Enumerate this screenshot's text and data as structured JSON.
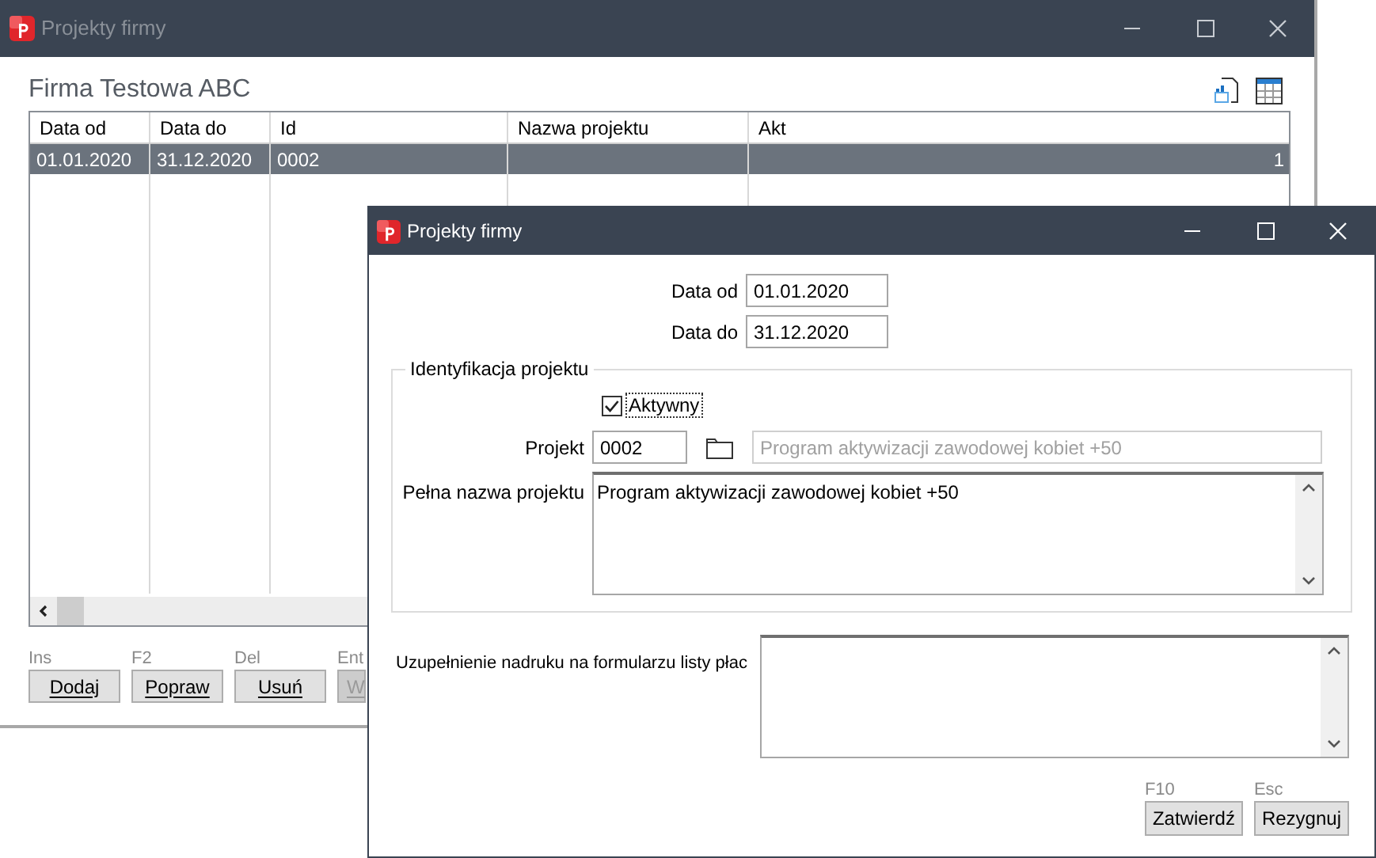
{
  "back_window": {
    "title": "Projekty firmy",
    "heading": "Firma Testowa ABC",
    "table": {
      "columns": [
        "Data od",
        "Data do",
        "Id",
        "Nazwa projektu",
        "Akt"
      ],
      "rows": [
        {
          "cells": [
            "01.01.2020",
            "31.12.2020",
            "0002",
            "",
            "1"
          ],
          "selected": true
        }
      ]
    },
    "actions": [
      {
        "hotkey": "Ins",
        "label": "Dodaj",
        "disabled": false
      },
      {
        "hotkey": "F2",
        "label": "Popraw",
        "disabled": false
      },
      {
        "hotkey": "Del",
        "label": "Usuń",
        "disabled": false
      },
      {
        "hotkey": "Ent",
        "label": "W",
        "disabled": true
      }
    ]
  },
  "dialog": {
    "title": "Projekty firmy",
    "date_from": {
      "label": "Data od",
      "value": "01.01.2020"
    },
    "date_to": {
      "label": "Data do",
      "value": "31.12.2020"
    },
    "group": {
      "legend": "Identyfikacja projektu",
      "active": {
        "label": "Aktywny",
        "checked": true
      },
      "project": {
        "label": "Projekt",
        "id": "0002",
        "name": "Program aktywizacji zawodowej kobiet +50"
      },
      "full_name": {
        "label": "Pełna nazwa projektu",
        "value": "Program aktywizacji zawodowej kobiet +50"
      }
    },
    "print_note": {
      "label": "Uzupełnienie nadruku na formularzu listy płac"
    },
    "buttons": [
      {
        "hotkey": "F10",
        "label": "Zatwierdź"
      },
      {
        "hotkey": "Esc",
        "label": "Rezygnuj"
      }
    ]
  }
}
